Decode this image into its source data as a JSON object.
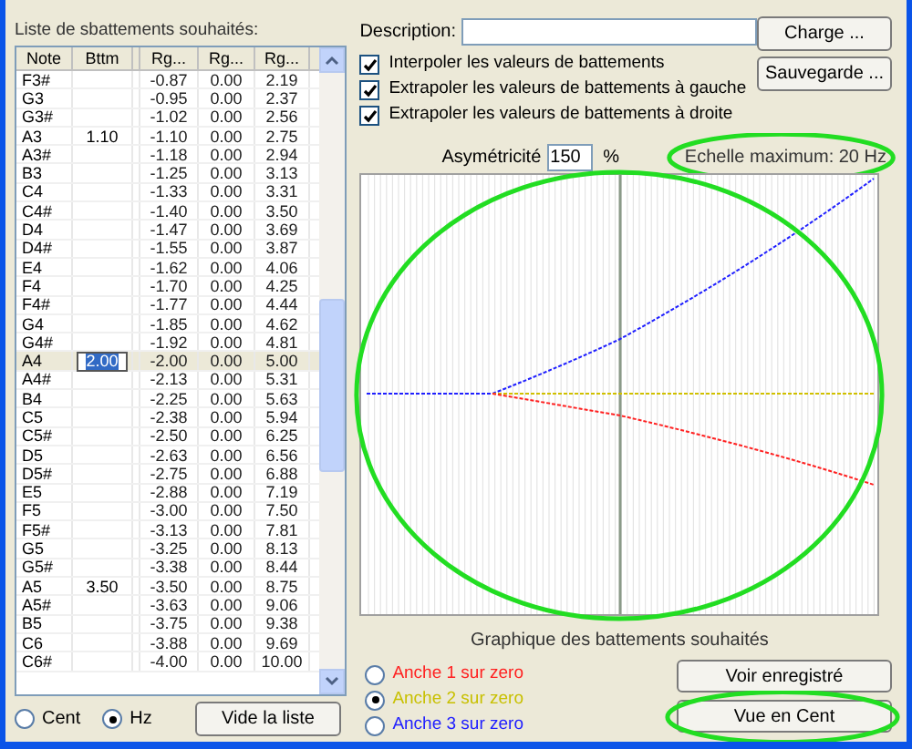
{
  "list": {
    "title": "Liste de sbattements souhaités:",
    "columns": [
      "Note",
      "Bttm",
      "",
      "Rg...",
      "Rg...",
      "Rg..."
    ],
    "rows": [
      {
        "note": "F3#",
        "bttm": "",
        "r1": "-0.87",
        "r2": "0.00",
        "r3": "2.19",
        "selected": false
      },
      {
        "note": "G3",
        "bttm": "",
        "r1": "-0.95",
        "r2": "0.00",
        "r3": "2.37",
        "selected": false
      },
      {
        "note": "G3#",
        "bttm": "",
        "r1": "-1.02",
        "r2": "0.00",
        "r3": "2.56",
        "selected": false
      },
      {
        "note": "A3",
        "bttm": "1.10",
        "r1": "-1.10",
        "r2": "0.00",
        "r3": "2.75",
        "selected": false
      },
      {
        "note": "A3#",
        "bttm": "",
        "r1": "-1.18",
        "r2": "0.00",
        "r3": "2.94",
        "selected": false
      },
      {
        "note": "B3",
        "bttm": "",
        "r1": "-1.25",
        "r2": "0.00",
        "r3": "3.13",
        "selected": false
      },
      {
        "note": "C4",
        "bttm": "",
        "r1": "-1.33",
        "r2": "0.00",
        "r3": "3.31",
        "selected": false
      },
      {
        "note": "C4#",
        "bttm": "",
        "r1": "-1.40",
        "r2": "0.00",
        "r3": "3.50",
        "selected": false
      },
      {
        "note": "D4",
        "bttm": "",
        "r1": "-1.47",
        "r2": "0.00",
        "r3": "3.69",
        "selected": false
      },
      {
        "note": "D4#",
        "bttm": "",
        "r1": "-1.55",
        "r2": "0.00",
        "r3": "3.87",
        "selected": false
      },
      {
        "note": "E4",
        "bttm": "",
        "r1": "-1.62",
        "r2": "0.00",
        "r3": "4.06",
        "selected": false
      },
      {
        "note": "F4",
        "bttm": "",
        "r1": "-1.70",
        "r2": "0.00",
        "r3": "4.25",
        "selected": false
      },
      {
        "note": "F4#",
        "bttm": "",
        "r1": "-1.77",
        "r2": "0.00",
        "r3": "4.44",
        "selected": false
      },
      {
        "note": "G4",
        "bttm": "",
        "r1": "-1.85",
        "r2": "0.00",
        "r3": "4.62",
        "selected": false
      },
      {
        "note": "G4#",
        "bttm": "",
        "r1": "-1.92",
        "r2": "0.00",
        "r3": "4.81",
        "selected": false
      },
      {
        "note": "A4",
        "bttm": "2.00",
        "r1": "-2.00",
        "r2": "0.00",
        "r3": "5.00",
        "selected": true
      },
      {
        "note": "A4#",
        "bttm": "",
        "r1": "-2.13",
        "r2": "0.00",
        "r3": "5.31",
        "selected": false
      },
      {
        "note": "B4",
        "bttm": "",
        "r1": "-2.25",
        "r2": "0.00",
        "r3": "5.63",
        "selected": false
      },
      {
        "note": "C5",
        "bttm": "",
        "r1": "-2.38",
        "r2": "0.00",
        "r3": "5.94",
        "selected": false
      },
      {
        "note": "C5#",
        "bttm": "",
        "r1": "-2.50",
        "r2": "0.00",
        "r3": "6.25",
        "selected": false
      },
      {
        "note": "D5",
        "bttm": "",
        "r1": "-2.63",
        "r2": "0.00",
        "r3": "6.56",
        "selected": false
      },
      {
        "note": "D5#",
        "bttm": "",
        "r1": "-2.75",
        "r2": "0.00",
        "r3": "6.88",
        "selected": false
      },
      {
        "note": "E5",
        "bttm": "",
        "r1": "-2.88",
        "r2": "0.00",
        "r3": "7.19",
        "selected": false
      },
      {
        "note": "F5",
        "bttm": "",
        "r1": "-3.00",
        "r2": "0.00",
        "r3": "7.50",
        "selected": false
      },
      {
        "note": "F5#",
        "bttm": "",
        "r1": "-3.13",
        "r2": "0.00",
        "r3": "7.81",
        "selected": false
      },
      {
        "note": "G5",
        "bttm": "",
        "r1": "-3.25",
        "r2": "0.00",
        "r3": "8.13",
        "selected": false
      },
      {
        "note": "G5#",
        "bttm": "",
        "r1": "-3.38",
        "r2": "0.00",
        "r3": "8.44",
        "selected": false
      },
      {
        "note": "A5",
        "bttm": "3.50",
        "r1": "-3.50",
        "r2": "0.00",
        "r3": "8.75",
        "selected": false
      },
      {
        "note": "A5#",
        "bttm": "",
        "r1": "-3.63",
        "r2": "0.00",
        "r3": "9.06",
        "selected": false
      },
      {
        "note": "B5",
        "bttm": "",
        "r1": "-3.75",
        "r2": "0.00",
        "r3": "9.38",
        "selected": false
      },
      {
        "note": "C6",
        "bttm": "",
        "r1": "-3.88",
        "r2": "0.00",
        "r3": "9.69",
        "selected": false
      },
      {
        "note": "C6#",
        "bttm": "",
        "r1": "-4.00",
        "r2": "0.00",
        "r3": "10.00",
        "selected": false
      }
    ]
  },
  "units": [
    {
      "label": "Cent",
      "selected": false
    },
    {
      "label": "Hz",
      "selected": true
    }
  ],
  "clear_button": "Vide la liste",
  "description": {
    "label": "Description:"
  },
  "buttons": [
    "Charge ...",
    "Sauvegarde ..."
  ],
  "options": [
    {
      "label": "Interpoler les valeurs de battements",
      "checked": true
    },
    {
      "label": "Extrapoler les valeurs de battements à gauche",
      "checked": true
    },
    {
      "label": "Extrapoler les valeurs de battements à droite",
      "checked": true
    }
  ],
  "asymmetry": {
    "label": "Asymétricité",
    "value": "150",
    "unit": "%"
  },
  "scale": {
    "label": "Echelle maximum: 20 Hz",
    "highlighted": true
  },
  "chart": {
    "caption": "Graphique des battements souhaités",
    "highlighted": true
  },
  "reeds": [
    {
      "label": "Anche 1 sur zero",
      "color": "#ff2020",
      "selected": false
    },
    {
      "label": "Anche 2 sur zero",
      "color": "#c8c000",
      "selected": true
    },
    {
      "label": "Anche 3 sur zero",
      "color": "#2020ff",
      "selected": false
    }
  ],
  "view_buttons": [
    {
      "label": "Voir enregistré",
      "highlighted": false
    },
    {
      "label": "Vue en Cent",
      "highlighted": true
    }
  ]
}
